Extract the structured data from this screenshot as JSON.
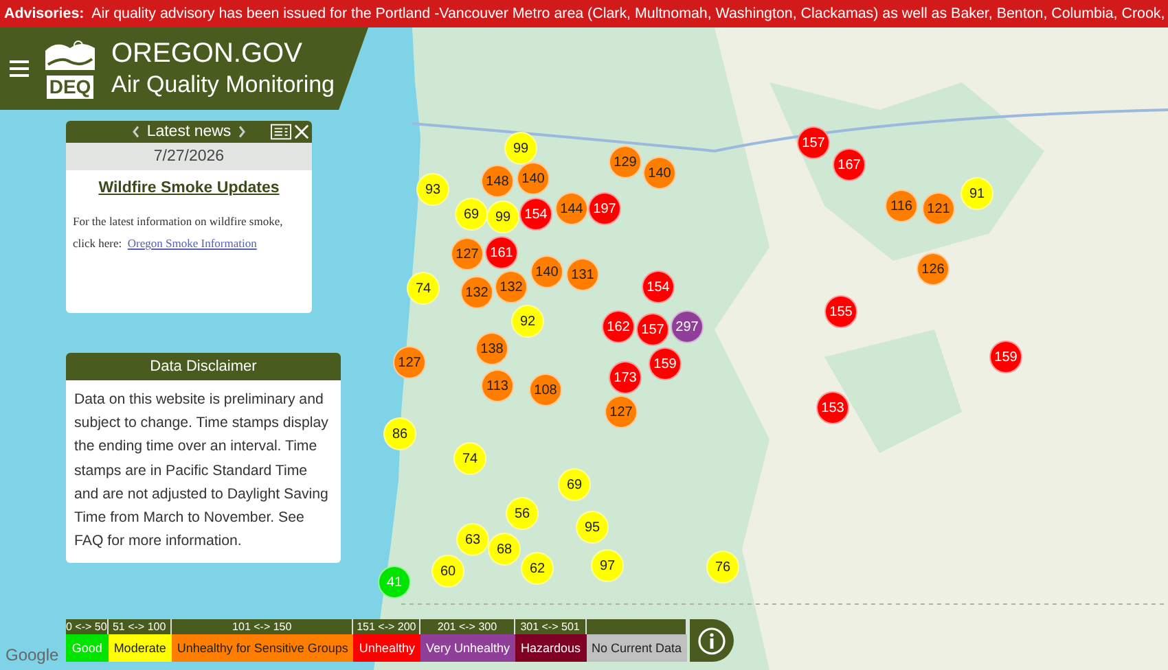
{
  "advisory": {
    "label": "Advisories:",
    "text": "Air quality advisory has been issued for the Portland -Vancouver Metro area (Clark, Multnomah, Washington, Clackamas) as well as Baker, Benton, Columbia, Crook,"
  },
  "header": {
    "site": "OREGON.GOV",
    "title": "Air Quality Monitoring",
    "logo_text": "DEQ"
  },
  "news": {
    "title": "Latest news",
    "date": "7/27/2026",
    "headline": "Wildfire Smoke Updates",
    "body": "For the latest information on wildfire smoke, click here:",
    "link": "Oregon Smoke Information"
  },
  "disclaimer": {
    "title": "Data Disclaimer",
    "text": "Data on this website is preliminary and subject to change. Time stamps display the ending time over an interval. Time stamps are in Pacific Standard Time and are not adjusted to Daylight Saving Time from March to November. See FAQ for more information."
  },
  "map": {
    "attribution": "Google"
  },
  "markers": [
    {
      "value": "99",
      "color": "#ffff00"
    },
    {
      "value": "93",
      "color": "#ffff00"
    },
    {
      "value": "148",
      "color": "#ff7e00"
    },
    {
      "value": "140",
      "color": "#ff7e00"
    },
    {
      "value": "154",
      "color": "#ff0000"
    },
    {
      "value": "144",
      "color": "#ff7e00"
    },
    {
      "value": "129",
      "color": "#ff7e00"
    },
    {
      "value": "140",
      "color": "#ff7e00"
    },
    {
      "value": "157",
      "color": "#ff0000"
    },
    {
      "value": "167",
      "color": "#ff0000"
    },
    {
      "value": "197",
      "color": "#ff0000"
    },
    {
      "value": "69",
      "color": "#ffff00"
    },
    {
      "value": "99",
      "color": "#ffff00"
    },
    {
      "value": "127",
      "color": "#ff7e00"
    },
    {
      "value": "161",
      "color": "#ff0000"
    },
    {
      "value": "132",
      "color": "#ff7e00"
    },
    {
      "value": "140",
      "color": "#ff7e00"
    },
    {
      "value": "131",
      "color": "#ff7e00"
    },
    {
      "value": "74",
      "color": "#ffff00"
    },
    {
      "value": "132",
      "color": "#ff7e00"
    },
    {
      "value": "92",
      "color": "#ffff00"
    },
    {
      "value": "154",
      "color": "#ff0000"
    },
    {
      "value": "162",
      "color": "#ff0000"
    },
    {
      "value": "157",
      "color": "#ff0000"
    },
    {
      "value": "297",
      "color": "#8f3f97"
    },
    {
      "value": "159",
      "color": "#ff0000"
    },
    {
      "value": "173",
      "color": "#ff0000"
    },
    {
      "value": "127",
      "color": "#ff7e00"
    },
    {
      "value": "138",
      "color": "#ff7e00"
    },
    {
      "value": "113",
      "color": "#ff7e00"
    },
    {
      "value": "108",
      "color": "#ff7e00"
    },
    {
      "value": "127",
      "color": "#ff7e00"
    },
    {
      "value": "91",
      "color": "#ffff00"
    },
    {
      "value": "116",
      "color": "#ff7e00"
    },
    {
      "value": "121",
      "color": "#ff7e00"
    },
    {
      "value": "126",
      "color": "#ff7e00"
    },
    {
      "value": "155",
      "color": "#ff0000"
    },
    {
      "value": "159",
      "color": "#ff0000"
    },
    {
      "value": "153",
      "color": "#ff0000"
    },
    {
      "value": "86",
      "color": "#ffff00"
    },
    {
      "value": "74",
      "color": "#ffff00"
    },
    {
      "value": "69",
      "color": "#ffff00"
    },
    {
      "value": "56",
      "color": "#ffff00"
    },
    {
      "value": "95",
      "color": "#ffff00"
    },
    {
      "value": "63",
      "color": "#ffff00"
    },
    {
      "value": "68",
      "color": "#ffff00"
    },
    {
      "value": "62",
      "color": "#ffff00"
    },
    {
      "value": "97",
      "color": "#ffff00"
    },
    {
      "value": "76",
      "color": "#ffff00"
    },
    {
      "value": "60",
      "color": "#ffff00"
    },
    {
      "value": "41",
      "color": "#00e400"
    }
  ],
  "legend": [
    {
      "range": "0 <-> 50",
      "label": "Good",
      "color": "#00e400"
    },
    {
      "range": "51 <-> 100",
      "label": "Moderate",
      "color": "#ffff00"
    },
    {
      "range": "101 <-> 150",
      "label": "Unhealthy for Sensitive Groups",
      "color": "#ff7e00"
    },
    {
      "range": "151 <-> 200",
      "label": "Unhealthy",
      "color": "#ff0000"
    },
    {
      "range": "201 <-> 300",
      "label": "Very Unhealthy",
      "color": "#8f3f97"
    },
    {
      "range": "301 <-> 501",
      "label": "Hazardous",
      "color": "#7e0023"
    },
    {
      "label": "No Current Data",
      "color": "#c0c0c0"
    }
  ]
}
